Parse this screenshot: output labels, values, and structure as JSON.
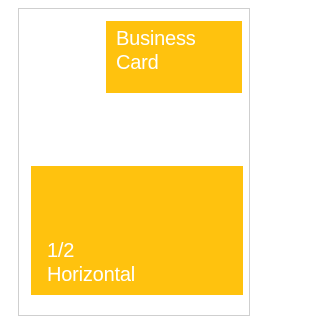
{
  "diagram": {
    "blocks": [
      {
        "id": "business-card",
        "label": "Business\nCard"
      },
      {
        "id": "half-horizontal",
        "label": "1/2\nHorizontal"
      }
    ],
    "colors": {
      "block_fill": "#ffc20e",
      "label_text": "#ffffff",
      "page_border": "#cfcfcf",
      "page_background": "#ffffff"
    }
  }
}
